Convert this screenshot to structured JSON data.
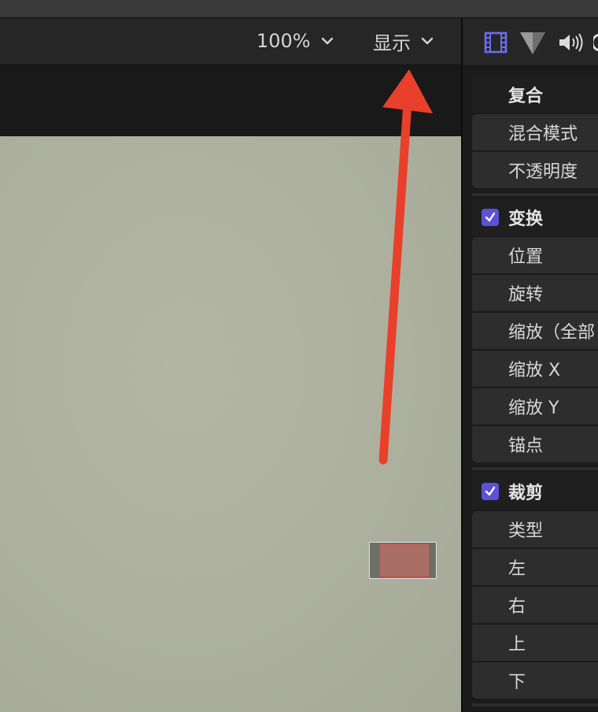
{
  "toolbar": {
    "zoom_label": "100%",
    "display_label": "显示"
  },
  "inspector": {
    "tabs": [
      {
        "icon": "film-icon"
      },
      {
        "icon": "color-triangle-icon"
      },
      {
        "icon": "speaker-icon"
      }
    ],
    "sections": {
      "composite": {
        "title": "复合",
        "items": [
          "混合模式",
          "不透明度"
        ]
      },
      "transform": {
        "title": "变换",
        "checked": true,
        "items": [
          "位置",
          "旋转",
          "缩放（全部",
          "缩放 X",
          "缩放 Y",
          "锚点"
        ]
      },
      "crop": {
        "title": "裁剪",
        "checked": true,
        "items": [
          "类型",
          "左",
          "右",
          "上",
          "下"
        ]
      }
    }
  },
  "colors": {
    "accent": "#5b52d6",
    "annotation_arrow": "#e8402a",
    "viewer_bg": "#adb09e"
  }
}
